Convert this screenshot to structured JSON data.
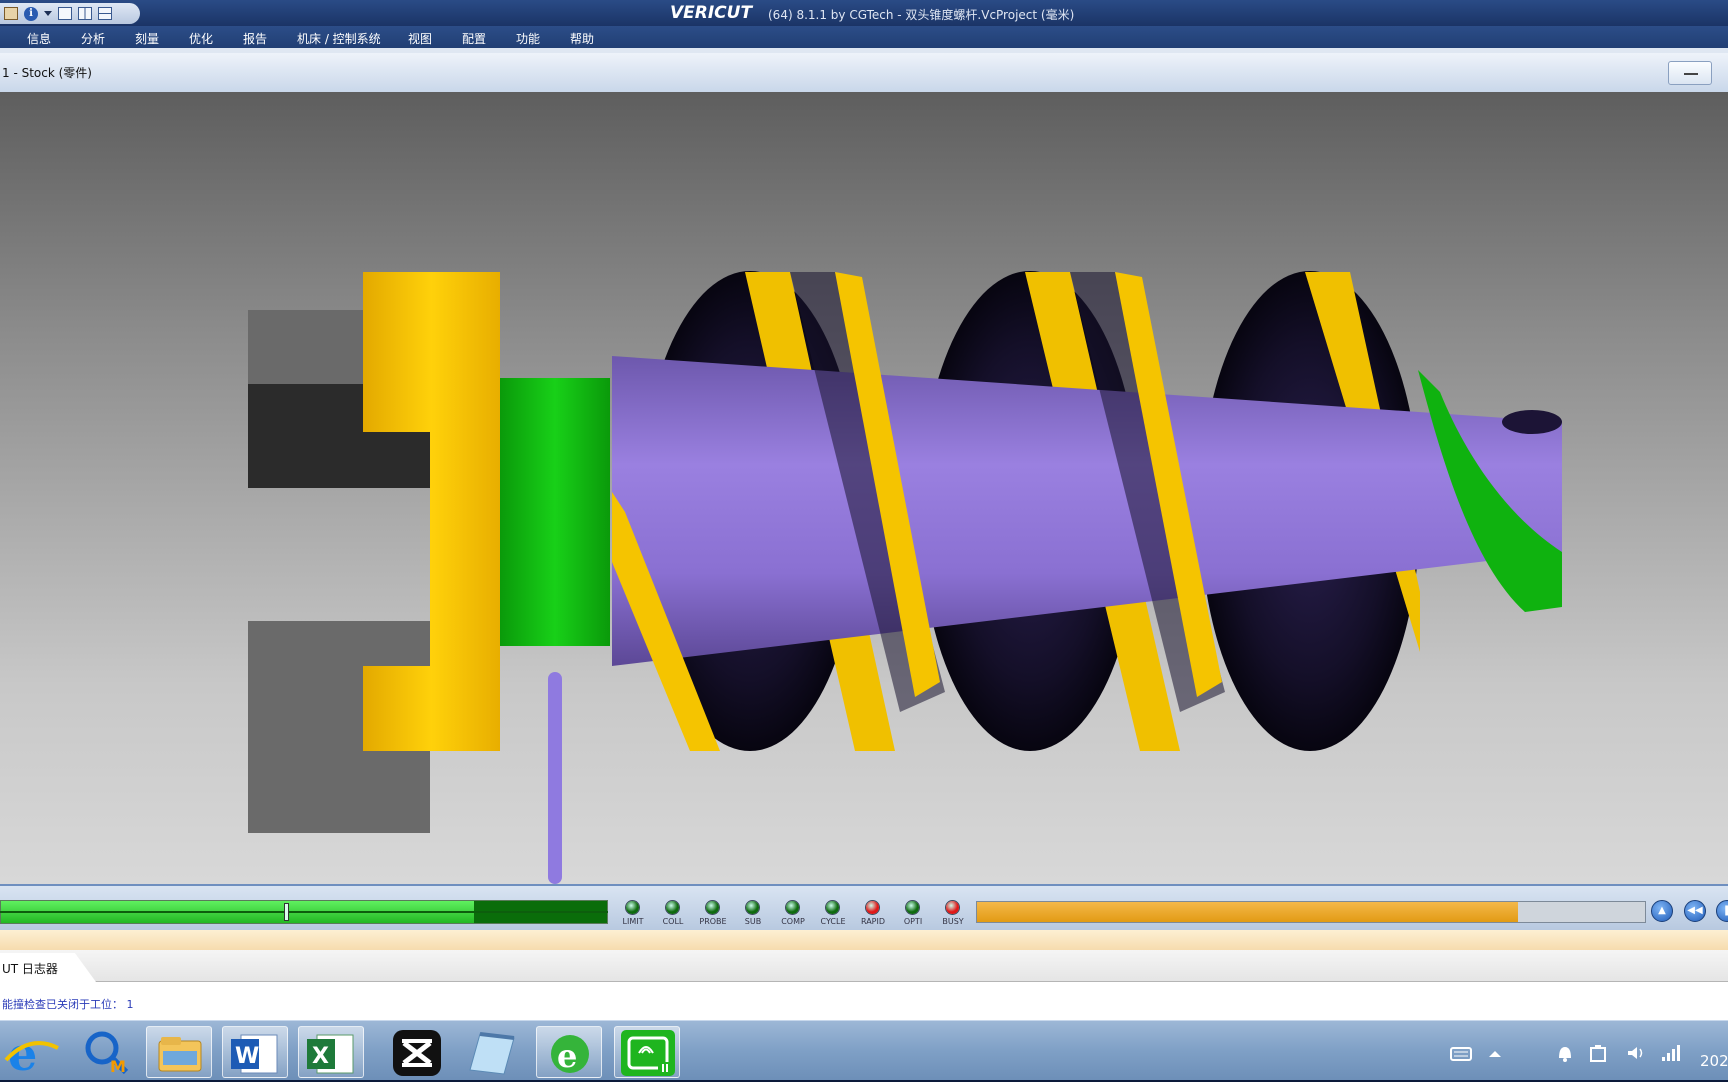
{
  "window": {
    "brand": "VERICUT",
    "title": "(64)  8.1.1 by CGTech - 双头锥度螺杆.VcProject (毫米)"
  },
  "menu": {
    "items": [
      "信息",
      "分析",
      "刻量",
      "优化",
      "报告",
      "机床 / 控制系统",
      "视图",
      "配置",
      "功能",
      "帮助"
    ]
  },
  "panel": {
    "title": "1 - Stock (零件)"
  },
  "status": {
    "progress": 0.78,
    "indicators": [
      {
        "label": "LIMIT",
        "color": "#0f6a0f"
      },
      {
        "label": "COLL",
        "color": "#0f6a0f"
      },
      {
        "label": "PROBE",
        "color": "#0f6a0f"
      },
      {
        "label": "SUB",
        "color": "#0f6a0f"
      },
      {
        "label": "COMP",
        "color": "#0f6a0f"
      },
      {
        "label": "CYCLE",
        "color": "#0f6a0f"
      },
      {
        "label": "RAPID",
        "color": "#e01818"
      },
      {
        "label": "OPTI",
        "color": "#0f6a0f"
      },
      {
        "label": "BUSY",
        "color": "#e01818"
      }
    ],
    "overall_progress": 0.81
  },
  "log": {
    "tab_label": "UT 日志器",
    "line": "能撞检查已关闭于工位： 1"
  },
  "taskbar": {
    "apps": [
      "ie-icon",
      "mastercam-icon",
      "explorer-icon",
      "word-icon",
      "excel-icon",
      "capcut-icon",
      "notepad-icon",
      "ie-alt-icon",
      "recorder-icon"
    ],
    "clock": "202"
  },
  "colors": {
    "stock": "#9678d8",
    "fixture": "#f5c400",
    "green": "#0fb20f",
    "jaw_dark": "#2b2b2b",
    "jaw_gray": "#6a6a6a"
  }
}
